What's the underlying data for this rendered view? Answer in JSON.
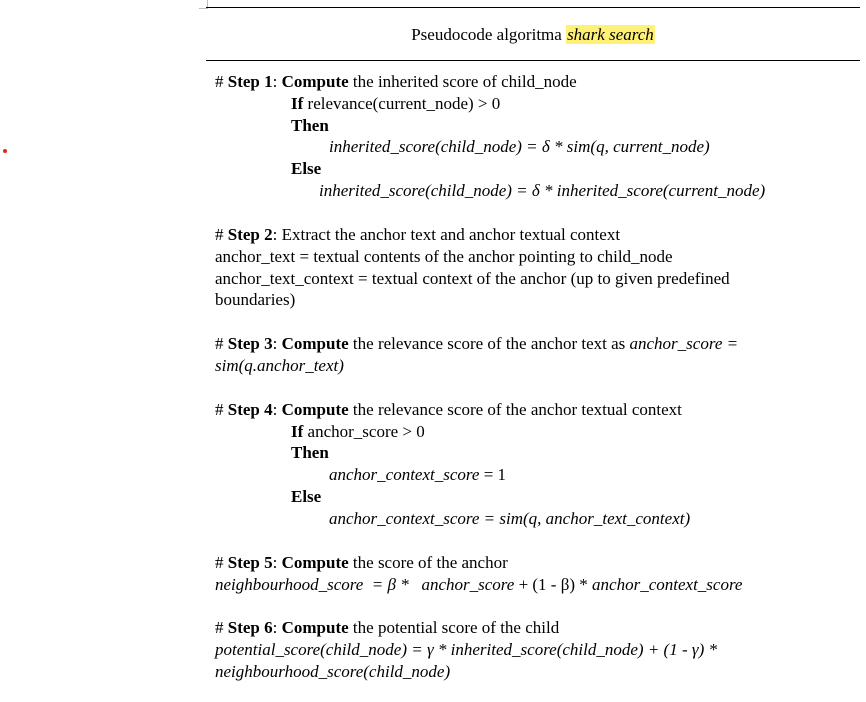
{
  "caption": {
    "prefix": "Pseudocode algoritma ",
    "highlight": "shark search"
  },
  "steps": {
    "s1": {
      "hash": "# ",
      "step": "Step 1",
      "colon": ": ",
      "verb": "Compute",
      "rest": " the inherited score of child_node",
      "if_kw": "If",
      "if_cond": " relevance(current_node) > 0",
      "then_kw": "Then",
      "then_expr": "inherited_score(child_node) = δ * sim(q, current_node)",
      "else_kw": "Else",
      "else_expr": "inherited_score(child_node) = δ * inherited_score(current_node)"
    },
    "s2": {
      "hash": "# ",
      "step": "Step 2",
      "rest": ": Extract the anchor text and anchor textual context",
      "line2": "anchor_text = textual contents of the anchor pointing to child_node",
      "line3": "anchor_text_context = textual context of the anchor (up to given predefined",
      "line4": "boundaries)"
    },
    "s3": {
      "hash": "# ",
      "step": "Step 3",
      "colon": ": ",
      "verb": "Compute",
      "rest": " the relevance score of the anchor text as ",
      "expr_a": "anchor_score =",
      "expr_b": "sim(q.anchor_text)"
    },
    "s4": {
      "hash": "# ",
      "step": "Step 4",
      "colon": ": ",
      "verb": "Compute",
      "rest": " the relevance score of the anchor textual context",
      "if_kw": "If",
      "if_cond": " anchor_score > 0",
      "then_kw": "Then",
      "then_expr_a": "anchor_context_score",
      "then_expr_b": " = 1",
      "else_kw": "Else",
      "else_expr": "anchor_context_score = sim(q, anchor_text_context)"
    },
    "s5": {
      "hash": "# ",
      "step": "Step 5",
      "colon": ": ",
      "verb": "Compute",
      "rest": " the score of the anchor",
      "expr_a": "neighbourhood_score  = β *   anchor_score",
      "expr_b": " + (1 - β) * ",
      "expr_c": "anchor_context_score"
    },
    "s6": {
      "hash": "# ",
      "step": "Step 6",
      "colon": ": ",
      "verb": "Compute",
      "rest": " the potential score of the child",
      "expr_a": "potential_score(child_node) = γ * inherited_score(child_node) + (1 - γ) *",
      "expr_b": "neighbourhood_score(child_node)"
    }
  }
}
